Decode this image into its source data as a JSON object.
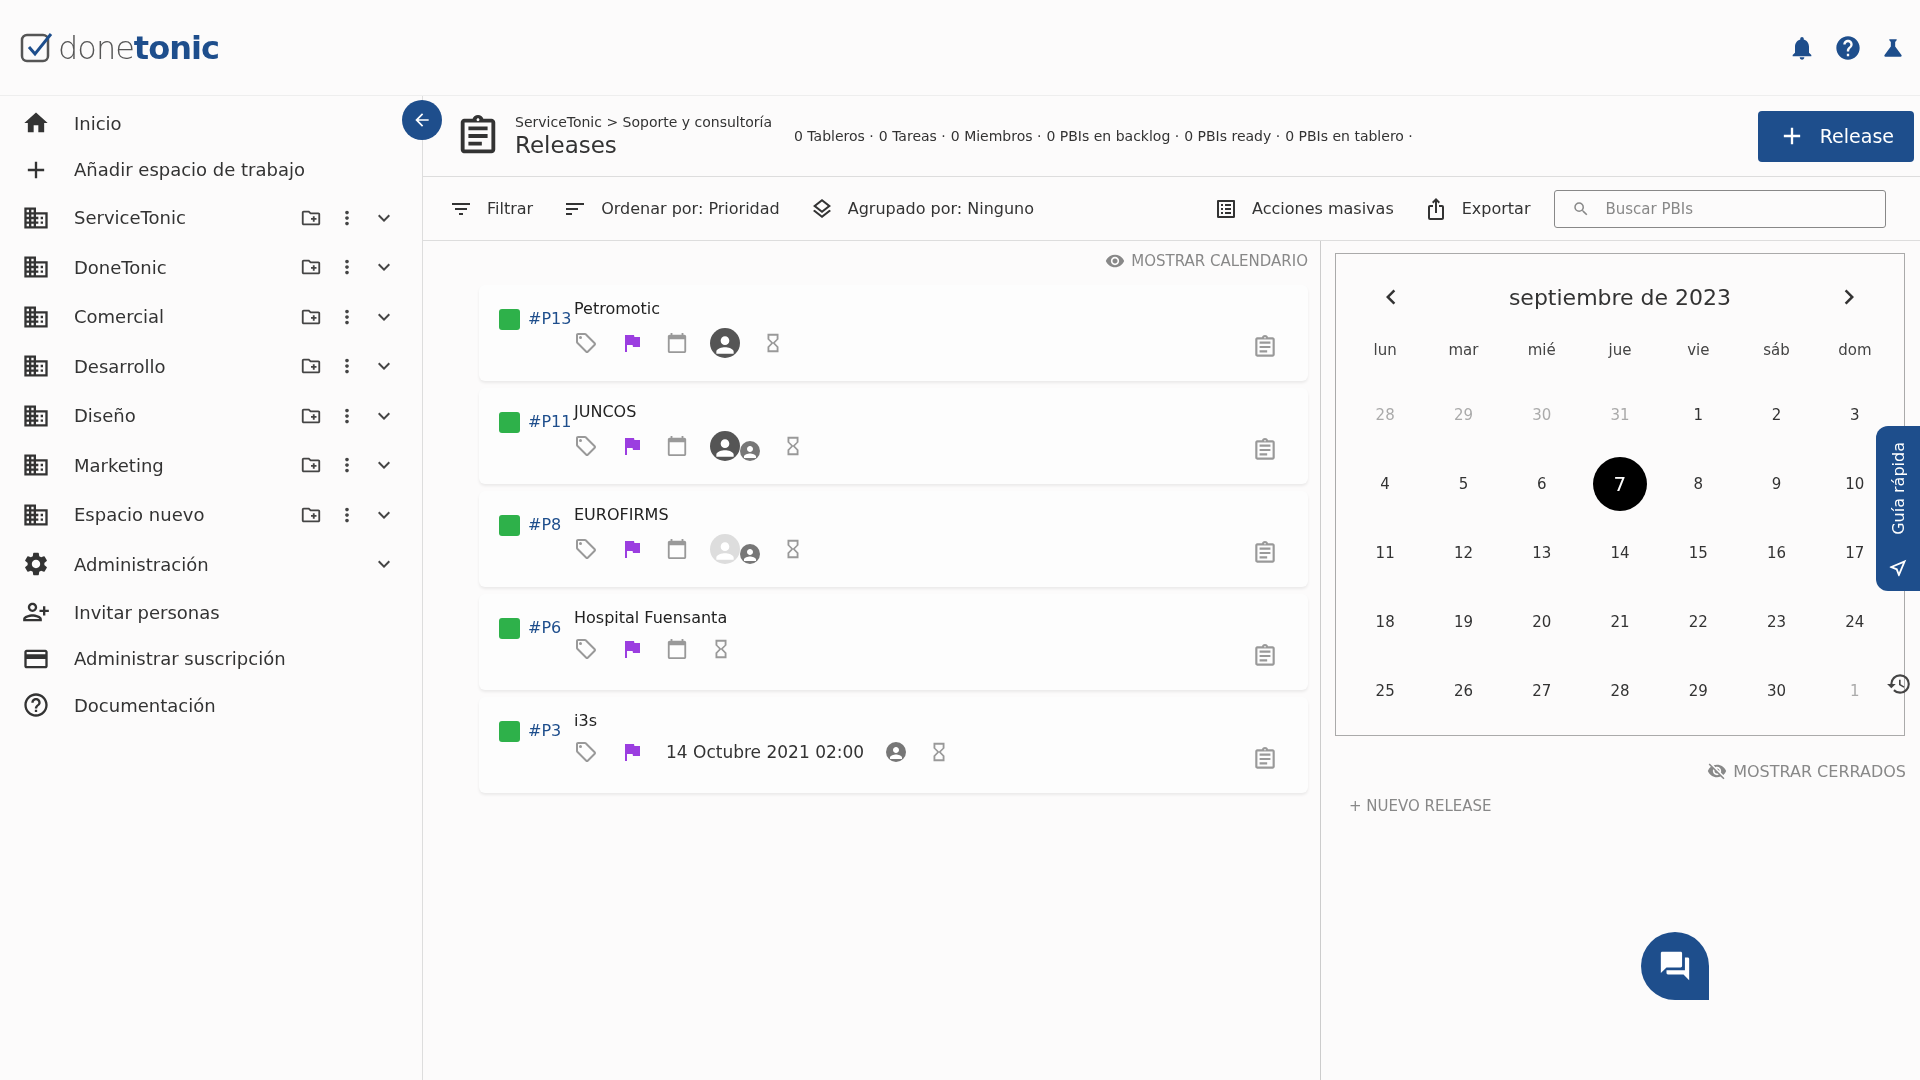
{
  "logo": {
    "light": "done",
    "bold": "tonic"
  },
  "sidebar": {
    "items": [
      {
        "kind": "home",
        "label": "Inicio"
      },
      {
        "kind": "add",
        "label": "Añadir espacio de trabajo"
      },
      {
        "kind": "workspace",
        "label": "ServiceTonic"
      },
      {
        "kind": "workspace",
        "label": "DoneTonic"
      },
      {
        "kind": "workspace",
        "label": "Comercial"
      },
      {
        "kind": "workspace",
        "label": "Desarrollo"
      },
      {
        "kind": "workspace",
        "label": "Diseño"
      },
      {
        "kind": "workspace",
        "label": "Marketing"
      },
      {
        "kind": "workspace",
        "label": "Espacio nuevo"
      },
      {
        "kind": "admin",
        "label": "Administración"
      },
      {
        "kind": "invite",
        "label": "Invitar personas"
      },
      {
        "kind": "subscription",
        "label": "Administrar suscripción"
      },
      {
        "kind": "docs",
        "label": "Documentación"
      }
    ]
  },
  "page": {
    "breadcrumb": "ServiceTonic > Soporte y consultoría",
    "title": "Releases",
    "stats": [
      "0 Tableros ·",
      "0 Tareas ·",
      "0 Miembros ·",
      "0 PBIs en backlog ·",
      "0 PBIs ready ·",
      "0 PBIs en tablero ·"
    ],
    "add_button": "Release"
  },
  "toolbar": {
    "filter": "Filtrar",
    "sort": "Ordenar por: Prioridad",
    "group": "Agrupado por: Ninguno",
    "bulk": "Acciones masivas",
    "export": "Exportar",
    "search": {
      "placeholder": "Buscar PBIs"
    }
  },
  "list": {
    "toggle": "MOSTRAR CALENDARIO",
    "releases": [
      {
        "id": "#P13",
        "name": "Petromotic",
        "color": "#2eb14a",
        "assignees": [
          {
            "kind": "photo"
          }
        ]
      },
      {
        "id": "#P11",
        "name": "JUNCOS",
        "color": "#2eb14a",
        "assignees": [
          {
            "kind": "photo"
          },
          {
            "kind": "small"
          }
        ]
      },
      {
        "id": "#P8",
        "name": "EUROFIRMS",
        "color": "#2eb14a",
        "assignees": [
          {
            "kind": "blank"
          },
          {
            "kind": "small"
          }
        ]
      },
      {
        "id": "#P6",
        "name": "Hospital Fuensanta",
        "color": "#2eb14a"
      },
      {
        "id": "#P3",
        "name": "i3s",
        "color": "#2eb14a",
        "date": "14 Octubre 2021 02:00",
        "assignees": [
          {
            "kind": "small"
          }
        ]
      }
    ]
  },
  "calendar": {
    "month": "septiembre de 2023",
    "weekdays": [
      "lun",
      "mar",
      "mié",
      "jue",
      "vie",
      "sáb",
      "dom"
    ],
    "weeks": [
      [
        {
          "day": "28",
          "muted": true,
          "selected": false
        },
        {
          "day": "29",
          "muted": true,
          "selected": false
        },
        {
          "day": "30",
          "muted": true,
          "selected": false
        },
        {
          "day": "31",
          "muted": true,
          "selected": false
        },
        {
          "day": "1",
          "muted": false,
          "selected": false
        },
        {
          "day": "2",
          "muted": false,
          "selected": false
        },
        {
          "day": "3",
          "muted": false,
          "selected": false
        }
      ],
      [
        {
          "day": "4",
          "muted": false,
          "selected": false
        },
        {
          "day": "5",
          "muted": false,
          "selected": false
        },
        {
          "day": "6",
          "muted": false,
          "selected": false
        },
        {
          "day": "7",
          "muted": false,
          "selected": true
        },
        {
          "day": "8",
          "muted": false,
          "selected": false
        },
        {
          "day": "9",
          "muted": false,
          "selected": false
        },
        {
          "day": "10",
          "muted": false,
          "selected": false
        }
      ],
      [
        {
          "day": "11",
          "muted": false,
          "selected": false
        },
        {
          "day": "12",
          "muted": false,
          "selected": false
        },
        {
          "day": "13",
          "muted": false,
          "selected": false
        },
        {
          "day": "14",
          "muted": false,
          "selected": false
        },
        {
          "day": "15",
          "muted": false,
          "selected": false
        },
        {
          "day": "16",
          "muted": false,
          "selected": false
        },
        {
          "day": "17",
          "muted": false,
          "selected": false
        }
      ],
      [
        {
          "day": "18",
          "muted": false,
          "selected": false
        },
        {
          "day": "19",
          "muted": false,
          "selected": false
        },
        {
          "day": "20",
          "muted": false,
          "selected": false
        },
        {
          "day": "21",
          "muted": false,
          "selected": false
        },
        {
          "day": "22",
          "muted": false,
          "selected": false
        },
        {
          "day": "23",
          "muted": false,
          "selected": false
        },
        {
          "day": "24",
          "muted": false,
          "selected": false
        }
      ],
      [
        {
          "day": "25",
          "muted": false,
          "selected": false
        },
        {
          "day": "26",
          "muted": false,
          "selected": false
        },
        {
          "day": "27",
          "muted": false,
          "selected": false
        },
        {
          "day": "28",
          "muted": false,
          "selected": false
        },
        {
          "day": "29",
          "muted": false,
          "selected": false
        },
        {
          "day": "30",
          "muted": false,
          "selected": false
        },
        {
          "day": "1",
          "muted": true,
          "selected": false
        }
      ]
    ],
    "show_closed": "MOSTRAR CERRADOS",
    "new_release": "+ NUEVO RELEASE"
  },
  "guide_tab": "Guía rápida"
}
